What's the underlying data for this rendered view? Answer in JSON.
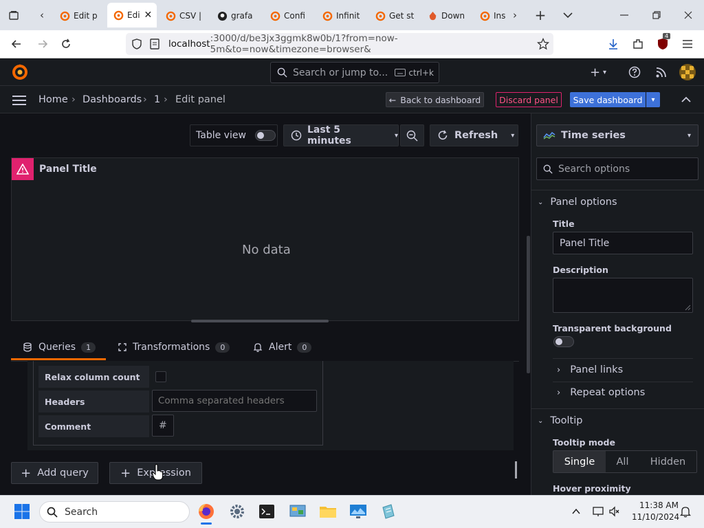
{
  "browser": {
    "tabs": [
      {
        "title": "Edit p",
        "icon": "grafana-icon"
      },
      {
        "title": "Edi",
        "icon": "grafana-icon",
        "active": true
      },
      {
        "title": "CSV |",
        "icon": "grafana-icon"
      },
      {
        "title": "grafa",
        "icon": "github-icon"
      },
      {
        "title": "Confi",
        "icon": "grafana-icon"
      },
      {
        "title": "Infinit",
        "icon": "infinity-icon"
      },
      {
        "title": "Get st",
        "icon": "grafana-icon"
      },
      {
        "title": "Down",
        "icon": "download-site-icon"
      },
      {
        "title": "Ins",
        "icon": "grafana-icon"
      }
    ],
    "url_host": "localhost",
    "url_rest": ":3000/d/be3jx3ggmk8w0b/1?from=now-5m&to=now&timezone=browser&",
    "ext_badge": "4"
  },
  "grafana": {
    "search_placeholder": "Search or jump to...",
    "search_shortcut": "ctrl+k",
    "breadcrumb": [
      "Home",
      "Dashboards",
      "1",
      "Edit panel"
    ],
    "back_to_dashboard": "Back to dashboard",
    "discard_panel": "Discard panel",
    "save_dashboard": "Save dashboard",
    "table_view": "Table view",
    "time_range": "Last 5 minutes",
    "refresh": "Refresh",
    "panel_title": "Panel Title",
    "no_data": "No data",
    "query_tabs": [
      {
        "label": "Queries",
        "count": "1"
      },
      {
        "label": "Transformations",
        "count": "0"
      },
      {
        "label": "Alert",
        "count": "0"
      }
    ],
    "csv_options": {
      "relax_column_count": "Relax column count",
      "headers_label": "Headers",
      "headers_placeholder": "Comma separated headers",
      "comment_label": "Comment",
      "comment_value": "#"
    },
    "add_query": "Add query",
    "expression": "Expression",
    "options": {
      "viz_type": "Time series",
      "search_placeholder": "Search options",
      "panel_options": "Panel options",
      "title_label": "Title",
      "title_value": "Panel Title",
      "description_label": "Description",
      "transparent_bg": "Transparent background",
      "panel_links": "Panel links",
      "repeat_options": "Repeat options",
      "tooltip": "Tooltip",
      "tooltip_mode": "Tooltip mode",
      "tooltip_modes": [
        "Single",
        "All",
        "Hidden"
      ],
      "hover_proximity": "Hover proximity"
    }
  },
  "taskbar": {
    "search": "Search",
    "time": "11:38 AM",
    "date": "11/10/2024"
  },
  "colors": {
    "grafana_orange": "#f46800",
    "primary_blue": "#3d71d9",
    "error_red": "#e0226e",
    "bg_dark": "#111217",
    "panel_bg": "#181b1f"
  }
}
